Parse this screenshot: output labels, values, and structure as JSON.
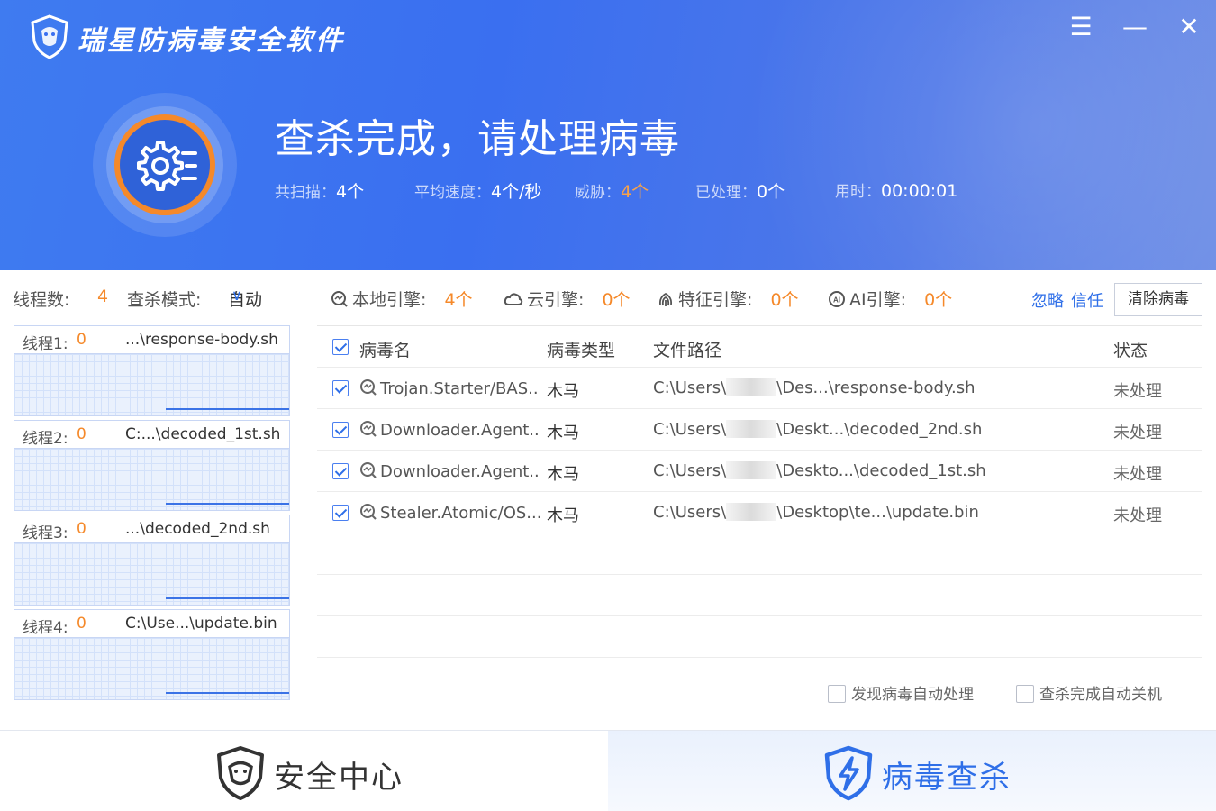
{
  "app": {
    "title": "瑞星防病毒安全软件",
    "window_controls": {
      "menu": "☰",
      "minimize": "—",
      "close": "✕"
    }
  },
  "header": {
    "status_title": "查杀完成，请处理病毒",
    "stats": [
      {
        "key": "共扫描：",
        "value": "4个"
      },
      {
        "key": "平均速度：",
        "value": "4个/秒"
      },
      {
        "key": "威胁：",
        "value": "4个",
        "highlight": true
      },
      {
        "key": "已处理：",
        "value": "0个"
      },
      {
        "key": "用时：",
        "value": "00:00:01"
      }
    ]
  },
  "left_panel": {
    "thread_label": "线程数:",
    "thread_count": "4",
    "mode_label": "查杀模式:",
    "mode_value": "自动",
    "threads": [
      {
        "label": "线程1:",
        "count": "0",
        "file": "...\\response-body.sh"
      },
      {
        "label": "线程2:",
        "count": "0",
        "file": "C:...\\decoded_1st.sh"
      },
      {
        "label": "线程3:",
        "count": "0",
        "file": "...\\decoded_2nd.sh"
      },
      {
        "label": "线程4:",
        "count": "0",
        "file": "C:\\Use...\\update.bin"
      }
    ]
  },
  "engines": [
    {
      "icon": "local-engine-icon",
      "label": "本地引擎:",
      "value": "4个"
    },
    {
      "icon": "cloud-icon",
      "label": "云引擎:",
      "value": "0个"
    },
    {
      "icon": "fingerprint-icon",
      "label": "特征引擎:",
      "value": "0个"
    },
    {
      "icon": "ai-icon",
      "label": "AI引擎:",
      "value": "0个"
    }
  ],
  "actions": {
    "ignore": "忽略",
    "trust": "信任",
    "clear": "清除病毒"
  },
  "table": {
    "headers": {
      "name": "病毒名",
      "type": "病毒类型",
      "path": "文件路径",
      "status": "状态"
    },
    "rows": [
      {
        "name": "Trojan.Starter/BAS...",
        "type": "木马",
        "path_prefix": "C:\\Users\\",
        "path_suffix": "\\Des...\\response-body.sh",
        "status": "未处理"
      },
      {
        "name": "Downloader.Agent...",
        "type": "木马",
        "path_prefix": "C:\\Users\\",
        "path_suffix": "\\Deskt...\\decoded_2nd.sh",
        "status": "未处理"
      },
      {
        "name": "Downloader.Agent...",
        "type": "木马",
        "path_prefix": "C:\\Users\\",
        "path_suffix": "\\Deskto...\\decoded_1st.sh",
        "status": "未处理"
      },
      {
        "name": "Stealer.Atomic/OS...",
        "type": "木马",
        "path_prefix": "C:\\Users\\",
        "path_suffix": "\\Desktop\\te...\\update.bin",
        "status": "未处理"
      }
    ]
  },
  "options": {
    "auto_handle": "发现病毒自动处理",
    "auto_shutdown": "查杀完成自动关机"
  },
  "bottom_nav": {
    "security_center": "安全中心",
    "virus_scan": "病毒查杀"
  },
  "colors": {
    "header_blue": "#3a6ff0",
    "accent_orange": "#f5892a",
    "link_blue": "#2f6fe8"
  }
}
